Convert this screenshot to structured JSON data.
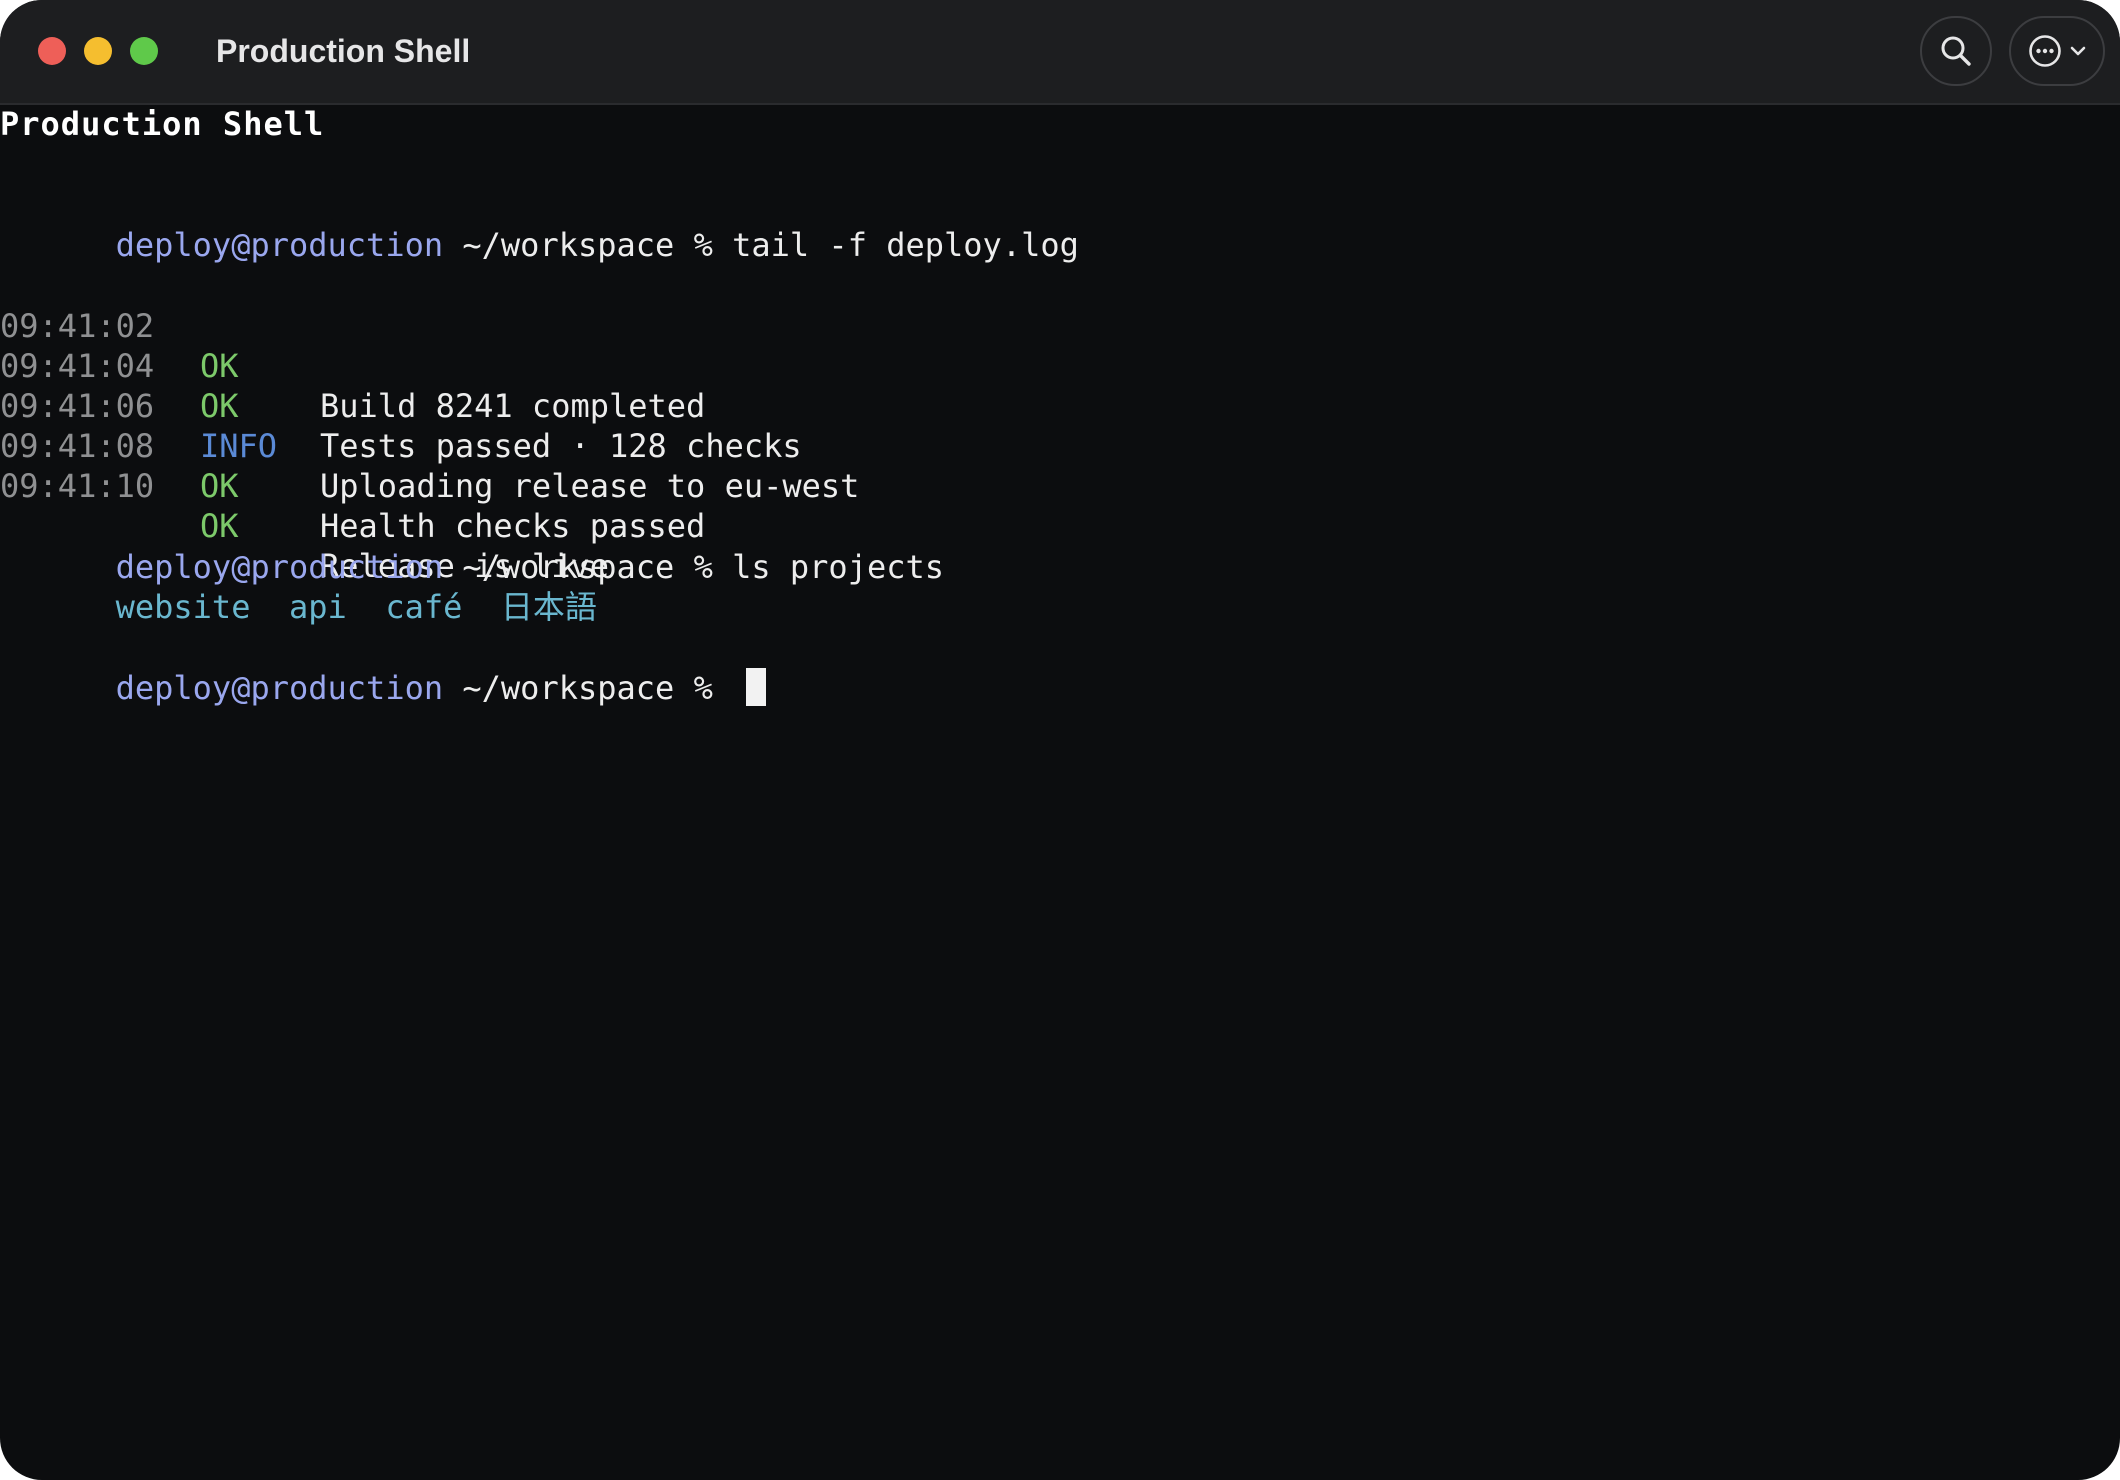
{
  "window": {
    "title": "Production Shell"
  },
  "toolbar": {
    "search_icon": "search-icon",
    "more_icon": "more-options-icon",
    "chevron_icon": "chevron-down-icon"
  },
  "terminal": {
    "heading": "Production Shell",
    "prompt": {
      "user_host": "deploy@production",
      "path": " ~/workspace % "
    },
    "command1": "tail -f deploy.log",
    "log": [
      {
        "time": "09:41:02",
        "level": "OK",
        "message": "Build 8241 completed"
      },
      {
        "time": "09:41:04",
        "level": "OK",
        "message": "Tests passed · 128 checks"
      },
      {
        "time": "09:41:06",
        "level": "INFO",
        "message": "Uploading release to eu-west"
      },
      {
        "time": "09:41:08",
        "level": "OK",
        "message": "Health checks passed"
      },
      {
        "time": "09:41:10",
        "level": "OK",
        "message": "Release is live"
      }
    ],
    "command2": "ls projects",
    "projects": [
      "website",
      "api",
      "café",
      "日本語"
    ]
  },
  "colors": {
    "background": "#0c0d0f",
    "titlebar": "#1d1e20",
    "prompt_user": "#9aa7ee",
    "ok": "#7cc96a",
    "info": "#5b8ad6",
    "directory": "#6ab7cf"
  }
}
